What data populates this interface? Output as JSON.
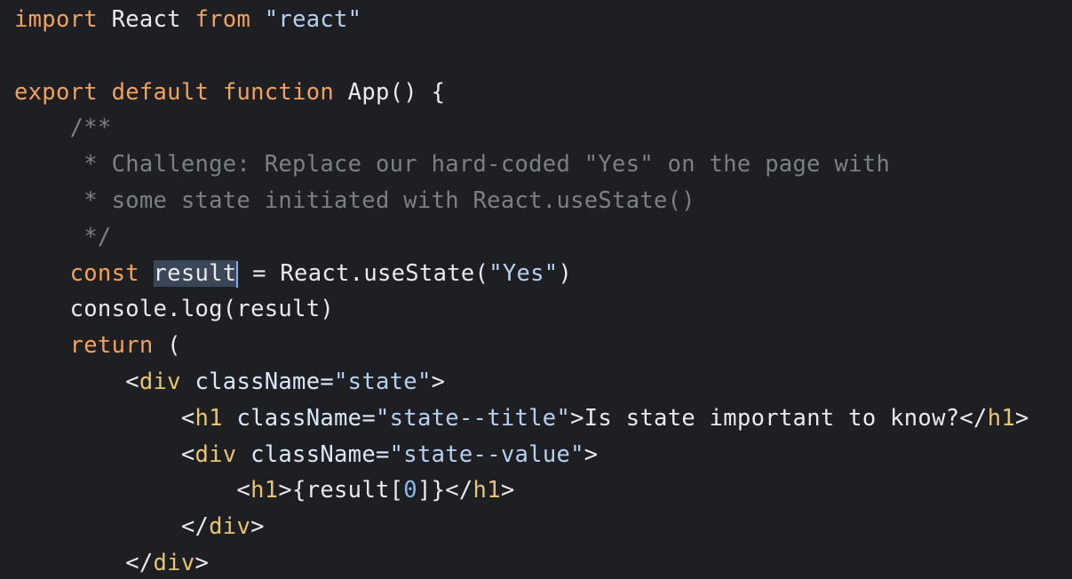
{
  "code_lines": [
    {
      "tokens": [
        {
          "t": "import",
          "c": "kw"
        },
        {
          "t": " React ",
          "c": "plain"
        },
        {
          "t": "from",
          "c": "kw"
        },
        {
          "t": " ",
          "c": "plain"
        },
        {
          "t": "\"react\"",
          "c": "str"
        }
      ]
    },
    {
      "tokens": []
    },
    {
      "tokens": [
        {
          "t": "export",
          "c": "kw"
        },
        {
          "t": " ",
          "c": "plain"
        },
        {
          "t": "default",
          "c": "kw"
        },
        {
          "t": " ",
          "c": "plain"
        },
        {
          "t": "function",
          "c": "kw"
        },
        {
          "t": " App() {",
          "c": "plain"
        }
      ]
    },
    {
      "tokens": [
        {
          "t": "    /**",
          "c": "cmt"
        }
      ]
    },
    {
      "tokens": [
        {
          "t": "     * Challenge: Replace our hard-coded \"Yes\" on the page with",
          "c": "cmt"
        }
      ]
    },
    {
      "tokens": [
        {
          "t": "     * some state initiated with React.useState()",
          "c": "cmt"
        }
      ]
    },
    {
      "tokens": [
        {
          "t": "     */",
          "c": "cmt"
        }
      ]
    },
    {
      "tokens": [
        {
          "t": "    ",
          "c": "plain"
        },
        {
          "t": "const",
          "c": "kw"
        },
        {
          "t": " ",
          "c": "plain"
        },
        {
          "t": "result",
          "c": "sel"
        },
        {
          "t": " = React.useState(",
          "c": "plain"
        },
        {
          "t": "\"Yes\"",
          "c": "str"
        },
        {
          "t": ")",
          "c": "plain"
        }
      ]
    },
    {
      "tokens": [
        {
          "t": "    console.log(result)",
          "c": "plain"
        }
      ]
    },
    {
      "tokens": [
        {
          "t": "    ",
          "c": "plain"
        },
        {
          "t": "return",
          "c": "kw"
        },
        {
          "t": " (",
          "c": "plain"
        }
      ]
    },
    {
      "tokens": [
        {
          "t": "        <",
          "c": "tag"
        },
        {
          "t": "div",
          "c": "tagname"
        },
        {
          "t": " className=",
          "c": "attr"
        },
        {
          "t": "\"state\"",
          "c": "str"
        },
        {
          "t": ">",
          "c": "tag"
        }
      ]
    },
    {
      "tokens": [
        {
          "t": "            <",
          "c": "tag"
        },
        {
          "t": "h1",
          "c": "tagname"
        },
        {
          "t": " className=",
          "c": "attr"
        },
        {
          "t": "\"state--title\"",
          "c": "str"
        },
        {
          "t": ">Is state important to know?</",
          "c": "tag"
        },
        {
          "t": "h1",
          "c": "tagname"
        },
        {
          "t": ">",
          "c": "tag"
        }
      ]
    },
    {
      "tokens": [
        {
          "t": "            <",
          "c": "tag"
        },
        {
          "t": "div",
          "c": "tagname"
        },
        {
          "t": " className=",
          "c": "attr"
        },
        {
          "t": "\"state--value\"",
          "c": "str"
        },
        {
          "t": ">",
          "c": "tag"
        }
      ]
    },
    {
      "tokens": [
        {
          "t": "                <",
          "c": "tag"
        },
        {
          "t": "h1",
          "c": "tagname"
        },
        {
          "t": ">{result[",
          "c": "tag"
        },
        {
          "t": "0",
          "c": "idx"
        },
        {
          "t": "]}</",
          "c": "tag"
        },
        {
          "t": "h1",
          "c": "tagname"
        },
        {
          "t": ">",
          "c": "tag"
        }
      ]
    },
    {
      "tokens": [
        {
          "t": "            </",
          "c": "tag"
        },
        {
          "t": "div",
          "c": "tagname"
        },
        {
          "t": ">",
          "c": "tag"
        }
      ]
    },
    {
      "tokens": [
        {
          "t": "        </",
          "c": "tag"
        },
        {
          "t": "div",
          "c": "tagname"
        },
        {
          "t": ">",
          "c": "tag"
        }
      ]
    }
  ],
  "colors": {
    "background": "#1e1f22",
    "keyword": "#f2a25a",
    "string": "#b6d1f0",
    "comment": "#7c7f86",
    "tag_name": "#e7c46d",
    "selection": "#3b4759",
    "caret": "#7fa8ff"
  }
}
